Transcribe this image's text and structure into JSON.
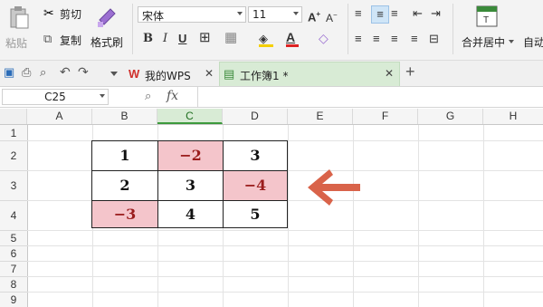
{
  "ribbon": {
    "paste_label": "粘贴",
    "cut_label": "剪切",
    "copy_label": "复制",
    "format_painter_label": "格式刷",
    "font_name": "宋体",
    "font_size": "11",
    "merge_center_label": "合并居中",
    "auto_label": "自动"
  },
  "tabs": {
    "tab1_label": "我的WPS",
    "tab2_label": "工作簿1 *"
  },
  "formula_bar": {
    "name_box": "C25",
    "fx_label": "fx",
    "value": ""
  },
  "grid": {
    "columns": [
      "A",
      "B",
      "C",
      "D",
      "E",
      "F",
      "G",
      "H"
    ],
    "rows": [
      "1",
      "2",
      "3",
      "4",
      "5",
      "6",
      "7",
      "8",
      "9"
    ],
    "cells": {
      "B2": "1",
      "C2": "−2",
      "D2": "3",
      "B3": "2",
      "C3": "3",
      "D3": "−4",
      "B4": "−3",
      "C4": "4",
      "D4": "5"
    }
  },
  "colors": {
    "highlight": "#f4c5cb",
    "arrow": "#d9634a",
    "active_column": "#d8ebd5"
  }
}
